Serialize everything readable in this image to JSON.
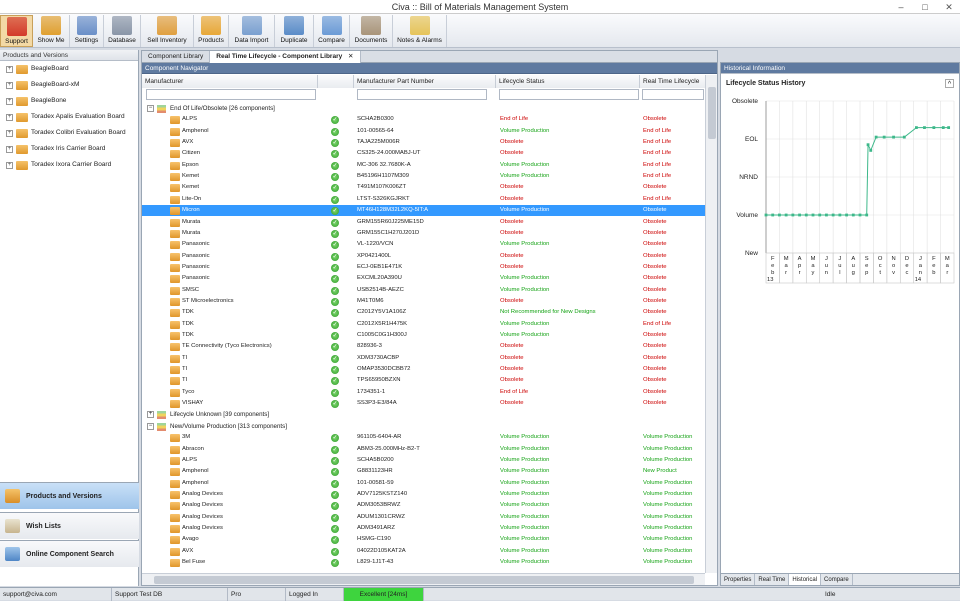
{
  "window": {
    "title": "Civa :: Bill of Materials Management System",
    "min": "–",
    "max": "□",
    "close": "✕"
  },
  "toolbar": [
    {
      "label": "Support",
      "icon": "lifebuoy-icon",
      "color": "#d33a2a",
      "active": true
    },
    {
      "label": "Show Me",
      "icon": "arrow-icon",
      "color": "#e0a030"
    },
    {
      "label": "Settings",
      "icon": "settings-icon",
      "color": "#6a8fc8"
    },
    {
      "label": "Database",
      "icon": "database-icon",
      "color": "#8a96a8"
    },
    {
      "label": "Sell Inventory",
      "icon": "people-icon",
      "color": "#e0a040"
    },
    {
      "label": "Products",
      "icon": "folder-icon",
      "color": "#e8a838"
    },
    {
      "label": "Data Import",
      "icon": "import-icon",
      "color": "#7aa0d0"
    },
    {
      "label": "Duplicate",
      "icon": "duplicate-icon",
      "color": "#5a8cc8"
    },
    {
      "label": "Compare",
      "icon": "compare-icon",
      "color": "#6b9bd6"
    },
    {
      "label": "Documents",
      "icon": "documents-icon",
      "color": "#a9957a"
    },
    {
      "label": "Notes & Alarms",
      "icon": "notes-icon",
      "color": "#e6c45a"
    }
  ],
  "left": {
    "header": "Products and Versions",
    "items": [
      "BeagleBoard",
      "BeagleBoard-xM",
      "BeagleBone",
      "Toradex Apalis Evaluation Board",
      "Toradex Colibri Evaluation Board",
      "Toradex Iris Carrier Board",
      "Toradex Ixora Carrier Board"
    ],
    "nav": [
      {
        "label": "Products and Versions",
        "active": true
      },
      {
        "label": "Wish Lists"
      },
      {
        "label": "Online Component Search"
      }
    ]
  },
  "center": {
    "tabs": [
      {
        "label": "Component Library"
      },
      {
        "label": "Real Time Lifecycle - Component Library",
        "selected": true
      }
    ],
    "close": "✕",
    "navigator": "Component Navigator",
    "columns": {
      "manufacturer": "Manufacturer",
      "part": "Manufacturer Part Number",
      "status": "Lifecycle Status",
      "rt": "Real Time Lifecycle Sta"
    },
    "rows": [
      {
        "g": true,
        "t": "End Of Life/Obsolete [26 components]",
        "exp": "−"
      },
      {
        "m": "ALPS",
        "p": "SCHA2B0300",
        "s": "End of Life",
        "r": "Obsolete"
      },
      {
        "m": "Amphenol",
        "p": "101-00565-64",
        "s": "Volume Production",
        "r": "End of Life"
      },
      {
        "m": "AVX",
        "p": "TAJA225M006R",
        "s": "Obsolete",
        "r": "End of Life"
      },
      {
        "m": "Citizen",
        "p": "CS325-24.000MABJ-UT",
        "s": "Obsolete",
        "r": "End of Life"
      },
      {
        "m": "Epson",
        "p": "MC-306 32.7680K-A",
        "s": "Volume Production",
        "r": "End of Life"
      },
      {
        "m": "Kemet",
        "p": "B45196H1107M309",
        "s": "Volume Production",
        "r": "End of Life"
      },
      {
        "m": "Kemet",
        "p": "T491M107K006ZT",
        "s": "Obsolete",
        "r": "Obsolete"
      },
      {
        "m": "Lite-On",
        "p": "LTST-S326KGJRKT",
        "s": "Obsolete",
        "r": "End of Life"
      },
      {
        "m": "Micron",
        "p": "MT46H128M32L2KQ-5IT:A",
        "s": "Volume Production",
        "r": "Obsolete",
        "sel": true
      },
      {
        "m": "Murata",
        "p": "GRM155R60J225ME15D",
        "s": "Obsolete",
        "r": "Obsolete"
      },
      {
        "m": "Murata",
        "p": "GRM155C1H270J201D",
        "s": "Obsolete",
        "r": "Obsolete"
      },
      {
        "m": "Panasonic",
        "p": "VL-1220/VCN",
        "s": "Volume Production",
        "r": "Obsolete"
      },
      {
        "m": "Panasonic",
        "p": "XP0421400L",
        "s": "Obsolete",
        "r": "Obsolete"
      },
      {
        "m": "Panasonic",
        "p": "ECJ-0EB1E471K",
        "s": "Obsolete",
        "r": "Obsolete"
      },
      {
        "m": "Panasonic",
        "p": "EXCML20A390U",
        "s": "Volume Production",
        "r": "Obsolete"
      },
      {
        "m": "SMSC",
        "p": "USB2514B-AEZC",
        "s": "Volume Production",
        "r": "Obsolete"
      },
      {
        "m": "ST Microelectronics",
        "p": "M41T0M6",
        "s": "Obsolete",
        "r": "Obsolete"
      },
      {
        "m": "TDK",
        "p": "C2012Y5V1A106Z",
        "s": "Not Recommended for New Designs",
        "r": "Obsolete"
      },
      {
        "m": "TDK",
        "p": "C2012X5R1H475K",
        "s": "Volume Production",
        "r": "End of Life"
      },
      {
        "m": "TDK",
        "p": "C1005C0G1H300J",
        "s": "Volume Production",
        "r": "Obsolete"
      },
      {
        "m": "TE Connectivity (Tyco Electronics)",
        "p": "828936-3",
        "s": "Obsolete",
        "r": "Obsolete"
      },
      {
        "m": "TI",
        "p": "XDM3730ACBP",
        "s": "Obsolete",
        "r": "Obsolete"
      },
      {
        "m": "TI",
        "p": "OMAP3530DCBB72",
        "s": "Obsolete",
        "r": "Obsolete"
      },
      {
        "m": "TI",
        "p": "TPS65950BZXN",
        "s": "Obsolete",
        "r": "Obsolete"
      },
      {
        "m": "Tyco",
        "p": "1734351-1",
        "s": "End of Life",
        "r": "Obsolete"
      },
      {
        "m": "VISHAY",
        "p": "SS3P3-E3/84A",
        "s": "Obsolete",
        "r": "Obsolete"
      },
      {
        "g": true,
        "t": "Lifecycle Unknown [39 components]",
        "exp": "+"
      },
      {
        "g": true,
        "t": "New/Volume Production [313 components]",
        "exp": "−"
      },
      {
        "m": "3M",
        "p": "961105-6404-AR",
        "s": "Volume Production",
        "r": "Volume Production"
      },
      {
        "m": "Abracon",
        "p": "ABM3-25.000MHz-B2-T",
        "s": "Volume Production",
        "r": "Volume Production"
      },
      {
        "m": "ALPS",
        "p": "SCHA5B0200",
        "s": "Volume Production",
        "r": "Volume Production"
      },
      {
        "m": "Amphenol",
        "p": "G8831123HR",
        "s": "Volume Production",
        "r": "New Product"
      },
      {
        "m": "Amphenol",
        "p": "101-00581-59",
        "s": "Volume Production",
        "r": "Volume Production"
      },
      {
        "m": "Analog Devices",
        "p": "ADV7125KSTZ140",
        "s": "Volume Production",
        "r": "Volume Production"
      },
      {
        "m": "Analog Devices",
        "p": "ADM3053BRWZ",
        "s": "Volume Production",
        "r": "Volume Production"
      },
      {
        "m": "Analog Devices",
        "p": "ADUM1301CRWZ",
        "s": "Volume Production",
        "r": "Volume Production"
      },
      {
        "m": "Analog Devices",
        "p": "ADM3491ARZ",
        "s": "Volume Production",
        "r": "Volume Production"
      },
      {
        "m": "Avago",
        "p": "HSMG-C190",
        "s": "Volume Production",
        "r": "Volume Production"
      },
      {
        "m": "AVX",
        "p": "04022D105KAT2A",
        "s": "Volume Production",
        "r": "Volume Production"
      },
      {
        "m": "Bel Fuse",
        "p": "L829-1J1T-43",
        "s": "Volume Production",
        "r": "Volume Production"
      }
    ]
  },
  "right": {
    "header": "Historical Information",
    "chart_title": "Lifecycle Status History",
    "collapse": "^",
    "tabs": [
      "Properties",
      "Real Time",
      "Historical",
      "Compare"
    ],
    "selected_tab": "Historical"
  },
  "chart_data": {
    "type": "line",
    "title": "Lifecycle Status History",
    "y_categories": [
      "New",
      "Volume",
      "NRND",
      "EOL",
      "Obsolete"
    ],
    "x_month_labels": [
      "Feb",
      "Mar",
      "Apr",
      "May",
      "Jun",
      "Jul",
      "Aug",
      "Sep",
      "Oct",
      "Nov",
      "Dec",
      "Jan",
      "Feb",
      "Mar"
    ],
    "x_year_labels": [
      {
        "label": "13",
        "at_month": 0
      },
      {
        "label": "14",
        "at_month": 11
      }
    ],
    "series": [
      {
        "color": "#3db88a",
        "points": [
          [
            0,
            1
          ],
          [
            0.5,
            1
          ],
          [
            1,
            1
          ],
          [
            1.5,
            1
          ],
          [
            2,
            1
          ],
          [
            2.5,
            1
          ],
          [
            3,
            1
          ],
          [
            3.5,
            1
          ],
          [
            4,
            1
          ],
          [
            4.5,
            1
          ],
          [
            5,
            1
          ],
          [
            5.5,
            1
          ],
          [
            6,
            1
          ],
          [
            6.5,
            1
          ],
          [
            7,
            1
          ],
          [
            7.5,
            1
          ],
          [
            7.6,
            2.85
          ],
          [
            7.8,
            2.7
          ],
          [
            8.2,
            3.05
          ],
          [
            8.8,
            3.05
          ],
          [
            9.5,
            3.05
          ],
          [
            10.3,
            3.05
          ],
          [
            11.2,
            3.3
          ],
          [
            11.8,
            3.3
          ],
          [
            12.5,
            3.3
          ],
          [
            13.2,
            3.3
          ],
          [
            13.6,
            3.3
          ]
        ]
      }
    ]
  },
  "status": [
    "support@civa.com",
    "Support Test DB",
    "Pro",
    "Logged In",
    "Excellent [24ms]",
    "Idle"
  ]
}
